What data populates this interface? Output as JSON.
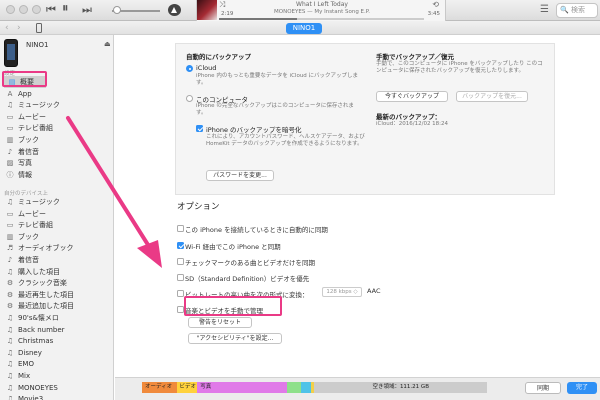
{
  "toolbar": {
    "song_title": "What I Left Today",
    "artist_album": "MONOEYES — My Instant Song E.P.",
    "time_elapsed": "2:19",
    "time_remaining": "3:45",
    "search_placeholder": "検索",
    "progress": 0.38,
    "volume": 0.05
  },
  "navbar": {
    "device_tab": "NINO1"
  },
  "sidebar": {
    "device_name": "NINO1",
    "section_settings": "設定",
    "settings_items": [
      {
        "label": "概要",
        "icon": "summary-icon"
      },
      {
        "label": "App",
        "icon": "app-icon"
      },
      {
        "label": "ミュージック",
        "icon": "music-icon"
      },
      {
        "label": "ムービー",
        "icon": "movie-icon"
      },
      {
        "label": "テレビ番組",
        "icon": "tv-icon"
      },
      {
        "label": "ブック",
        "icon": "book-icon"
      },
      {
        "label": "着信音",
        "icon": "bell-icon"
      },
      {
        "label": "写真",
        "icon": "photo-icon"
      },
      {
        "label": "情報",
        "icon": "info-icon"
      }
    ],
    "section_on_device": "自分のデバイス上",
    "device_items": [
      {
        "label": "ミュージック",
        "icon": "music-icon"
      },
      {
        "label": "ムービー",
        "icon": "movie-icon"
      },
      {
        "label": "テレビ番組",
        "icon": "tv-icon"
      },
      {
        "label": "ブック",
        "icon": "book-icon"
      },
      {
        "label": "オーディオブック",
        "icon": "audiobook-icon"
      },
      {
        "label": "着信音",
        "icon": "bell-icon"
      },
      {
        "label": "購入した項目",
        "icon": "playlist-icon"
      },
      {
        "label": "クラシック音楽",
        "icon": "gear-icon"
      },
      {
        "label": "最近再生した項目",
        "icon": "gear-icon"
      },
      {
        "label": "最近追加した項目",
        "icon": "gear-icon"
      },
      {
        "label": "90's&懐メロ",
        "icon": "playlist-icon"
      },
      {
        "label": "Back number",
        "icon": "playlist-icon"
      },
      {
        "label": "Christmas",
        "icon": "playlist-icon"
      },
      {
        "label": "Disney",
        "icon": "playlist-icon"
      },
      {
        "label": "EMO",
        "icon": "playlist-icon"
      },
      {
        "label": "Mix",
        "icon": "playlist-icon"
      },
      {
        "label": "MONOEYES",
        "icon": "playlist-icon"
      },
      {
        "label": "Movie3",
        "icon": "playlist-icon"
      }
    ]
  },
  "backup": {
    "auto_title": "自動的にバックアップ",
    "icloud_label": "iCloud",
    "icloud_desc": "iPhone 内のもっとも重要なデータを iCloud にバックアップします。",
    "computer_label": "このコンピュータ",
    "computer_desc": "iPhone の完全なバックアップはこのコンピュータに保存されます。",
    "encrypt_label": "iPhone のバックアップを暗号化",
    "encrypt_desc": "これにより、アカウントパスワード、ヘルスケアデータ、および HomeKit データのバックアップを作成できるようになります。",
    "change_password_button": "パスワードを変更...",
    "manual_title": "手動でバックアップ／復元",
    "manual_desc": "手動で、このコンピュータに iPhone をバックアップしたり このコンピュータに保存されたバックアップを復元したりします。",
    "backup_now_button": "今すぐバックアップ",
    "restore_button": "バックアップを復元...",
    "latest_title": "最新のバックアップ：",
    "latest_value": "iCloud：2016/12/02 18:24"
  },
  "options": {
    "title": "オプション",
    "items": [
      {
        "label": "この iPhone を接続しているときに自動的に同期",
        "checked": false
      },
      {
        "label": "Wi-Fi 経由でこの iPhone と同期",
        "checked": true
      },
      {
        "label": "チェックマークのある曲とビデオだけを同期",
        "checked": false
      },
      {
        "label": "SD（Standard Definition）ビデオを優先",
        "checked": false
      },
      {
        "label": "ビットレートの高い曲を次の形式に変換：",
        "checked": false
      },
      {
        "label": "音楽とビデオを手動で管理",
        "checked": false
      }
    ],
    "bitrate_value": "128 kbps ◇",
    "format_value": "AAC",
    "reset_warnings_button": "警告をリセット",
    "accessibility_button": "\"アクセシビリティ\"を設定..."
  },
  "storage": {
    "segments": [
      {
        "label": "オーディオ",
        "color": "#f08a3c",
        "fraction": 0.1
      },
      {
        "label": "ビデオ",
        "color": "#ffd23c",
        "fraction": 0.06
      },
      {
        "label": "写真",
        "color": "#e07ae8",
        "fraction": 0.26
      },
      {
        "label": "",
        "color": "#8ee08a",
        "fraction": 0.04
      },
      {
        "label": "",
        "color": "#4fc3e8",
        "fraction": 0.03
      },
      {
        "label": "",
        "color": "#f2d04a",
        "fraction": 0.01
      }
    ],
    "free_label": "空き領域：111.21 GB",
    "sync_button": "同期",
    "done_button": "完了"
  }
}
